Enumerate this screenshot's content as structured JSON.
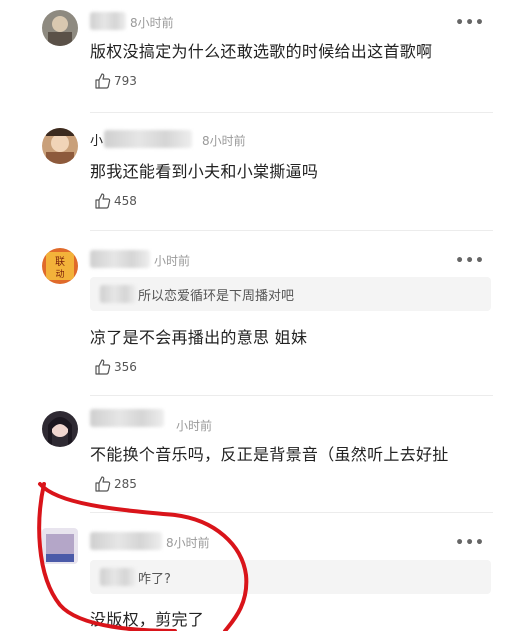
{
  "comments": [
    {
      "username": "▇大",
      "time": "8小时前",
      "text": "版权没搞定为什么还敢选歌的时候给出这首歌啊",
      "likes": "793"
    },
    {
      "username": "小",
      "time": "8小时前",
      "text": "那我还能看到小夫和小棠撕逼吗",
      "likes": "458"
    },
    {
      "username": "",
      "time": "小时前",
      "quote": "所以恋爱循环是下周播对吧",
      "text": "凉了是不会再播出的意思 姐妹",
      "likes": "356"
    },
    {
      "username": "",
      "time": "小时前",
      "text": "不能换个音乐吗，反正是背景音（虽然听上去好扯",
      "likes": "285"
    },
    {
      "username": "",
      "time": "8小时前",
      "quote": "咋了?",
      "text": "没版权，剪完了"
    }
  ],
  "icons": {
    "more": "more-dots-icon",
    "like": "thumbs-up-icon"
  },
  "colors": {
    "annotation": "#d9141a",
    "time": "#9a9a9a"
  }
}
